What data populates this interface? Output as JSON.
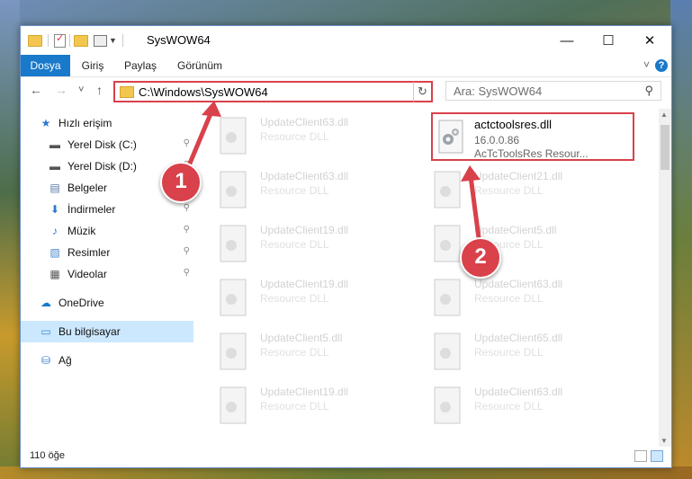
{
  "window": {
    "title": "SysWOW64",
    "minimize_glyph": "—",
    "maximize_glyph": "☐",
    "close_glyph": "✕"
  },
  "ribbon": {
    "tabs": [
      "Dosya",
      "Giriş",
      "Paylaş",
      "Görünüm"
    ],
    "help_glyph": "?",
    "collapse_glyph": "˅"
  },
  "navbar": {
    "back_glyph": "←",
    "forward_glyph": "→",
    "recent_glyph": "˅",
    "up_glyph": "↑",
    "address": "C:\\Windows\\SysWOW64",
    "address_dropdown_glyph": "˅",
    "refresh_glyph": "↻",
    "search_placeholder": "Ara: SysWOW64",
    "search_glyph": "⚲"
  },
  "sidebar": {
    "items": [
      {
        "label": "Hızlı erişim",
        "icon": "star-icon",
        "glyph": "★",
        "color": "#2b78d0",
        "pinned": false
      },
      {
        "label": "Yerel Disk (C:)",
        "icon": "drive-c-icon",
        "glyph": "▬",
        "color": "#555555",
        "pinned": true
      },
      {
        "label": "Yerel Disk (D:)",
        "icon": "drive-d-icon",
        "glyph": "▬",
        "color": "#555555",
        "pinned": true
      },
      {
        "label": "Belgeler",
        "icon": "documents-icon",
        "glyph": "▤",
        "color": "#5a7aa8",
        "pinned": true
      },
      {
        "label": "İndirmeler",
        "icon": "downloads-icon",
        "glyph": "⬇",
        "color": "#2b78d0",
        "pinned": true
      },
      {
        "label": "Müzik",
        "icon": "music-icon",
        "glyph": "♪",
        "color": "#2b78d0",
        "pinned": true
      },
      {
        "label": "Resimler",
        "icon": "pictures-icon",
        "glyph": "▧",
        "color": "#4a8ad0",
        "pinned": true
      },
      {
        "label": "Videolar",
        "icon": "videos-icon",
        "glyph": "▦",
        "color": "#555555",
        "pinned": true
      },
      {
        "label": "OneDrive",
        "icon": "onedrive-icon",
        "glyph": "☁",
        "color": "#1979ca",
        "pinned": false
      },
      {
        "label": "Bu bilgisayar",
        "icon": "computer-icon",
        "glyph": "▭",
        "color": "#3a8ad0",
        "pinned": false
      },
      {
        "label": "Ağ",
        "icon": "network-icon",
        "glyph": "⛁",
        "color": "#2b78d0",
        "pinned": false
      }
    ],
    "pin_glyph": "📌"
  },
  "files": {
    "highlighted": {
      "name": "actctoolsres.dll",
      "version": "16.0.0.86",
      "description": "AcTcToolsRes Resour..."
    },
    "faded": [
      {
        "name": "UpdateClient63.dll",
        "description": "Resource DLL"
      },
      {
        "name": "UpdateClient63.dll",
        "description": "Resource DLL"
      },
      {
        "name": "UpdateClient21.dll",
        "description": "Resource DLL"
      },
      {
        "name": "UpdateClient19.dll",
        "description": "Resource DLL"
      },
      {
        "name": "UpdateClient5.dll",
        "description": "Resource DLL"
      },
      {
        "name": "UpdateClient19.dll",
        "description": "Resource DLL"
      },
      {
        "name": "UpdateClient63.dll",
        "description": "Resource DLL"
      },
      {
        "name": "UpdateClient5.dll",
        "description": "Resource DLL"
      },
      {
        "name": "UpdateClient65.dll",
        "description": "Resource DLL"
      },
      {
        "name": "UpdateClient19.dll",
        "description": "Resource DLL"
      },
      {
        "name": "UpdateClient63.dll",
        "description": "Resource DLL"
      }
    ]
  },
  "status": {
    "item_count": "110 öğe"
  },
  "callouts": [
    "1",
    "2"
  ],
  "colors": {
    "accent": "#1979ca",
    "highlight": "#d9414b",
    "selection": "#cce8ff"
  }
}
